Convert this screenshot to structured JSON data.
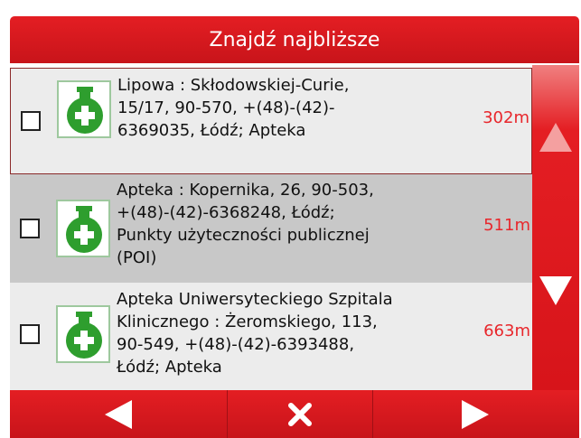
{
  "header": {
    "title": "Znajdź najbliższe"
  },
  "results": [
    {
      "line1": "Lipowa : Skłodowskiej-Curie,",
      "line2": "15/17, 90-570, +(48)-(42)-",
      "line3": "6369035, Łódź; Apteka",
      "line4": "",
      "distance": "302m",
      "checked": false,
      "icon": "pharmacy-icon"
    },
    {
      "line1": "Apteka : Kopernika, 26, 90-503,",
      "line2": "+(48)-(42)-6368248, Łódź;",
      "line3": "Punkty użyteczności publicznej",
      "line4": "(POI)",
      "distance": "511m",
      "checked": false,
      "icon": "pharmacy-icon"
    },
    {
      "line1": "Apteka Uniwersyteckiego Szpitala",
      "line2": "Klinicznego : Żeromskiego, 113,",
      "line3": "90-549, +(48)-(42)-6393488,",
      "line4": "Łódź; Apteka",
      "distance": "663m",
      "checked": false,
      "icon": "pharmacy-icon"
    }
  ],
  "scrollbar": {
    "up_icon": "triangle-up-icon",
    "down_icon": "triangle-down-icon"
  },
  "footer": {
    "prev_icon": "arrow-left-icon",
    "close_icon": "close-icon",
    "next_icon": "arrow-right-icon"
  },
  "colors": {
    "accent": "#e41e23",
    "distance": "#e8262b",
    "icon_green": "#2e9e2e"
  }
}
